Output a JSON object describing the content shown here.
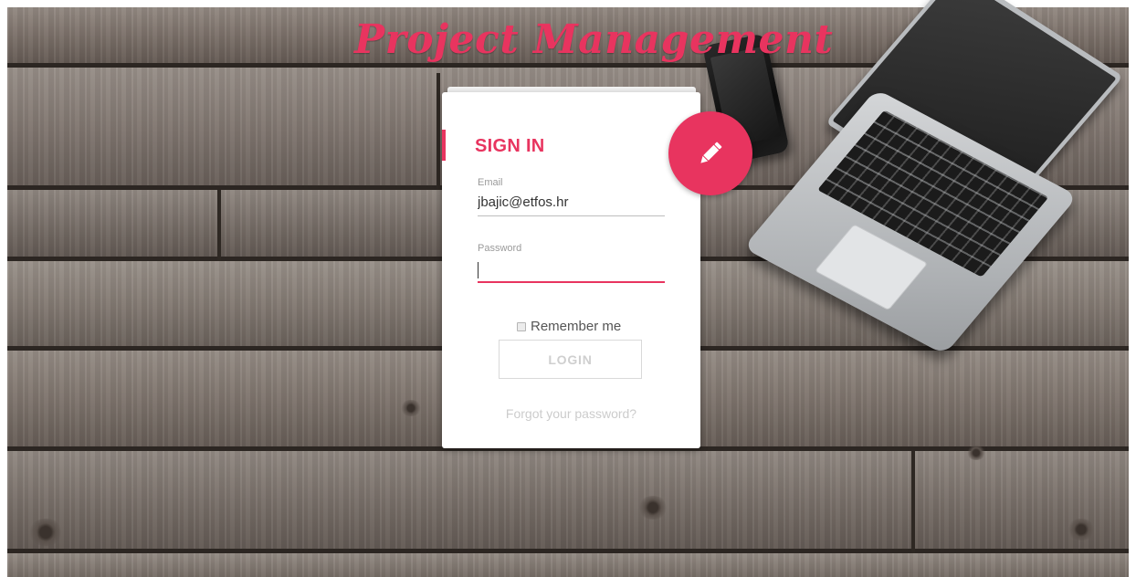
{
  "app": {
    "title": "Project Management"
  },
  "login_card": {
    "heading": "SIGN IN",
    "email": {
      "label": "Email",
      "value": "jbajic@etfos.hr"
    },
    "password": {
      "label": "Password",
      "value": ""
    },
    "remember_label": "Remember me",
    "login_label": "LOGIN",
    "forgot_label": "Forgot your password?"
  },
  "icons": {
    "fab": "pencil-icon"
  },
  "colors": {
    "accent": "#e8345f",
    "card": "#ffffff",
    "muted_text": "#cccccc"
  }
}
